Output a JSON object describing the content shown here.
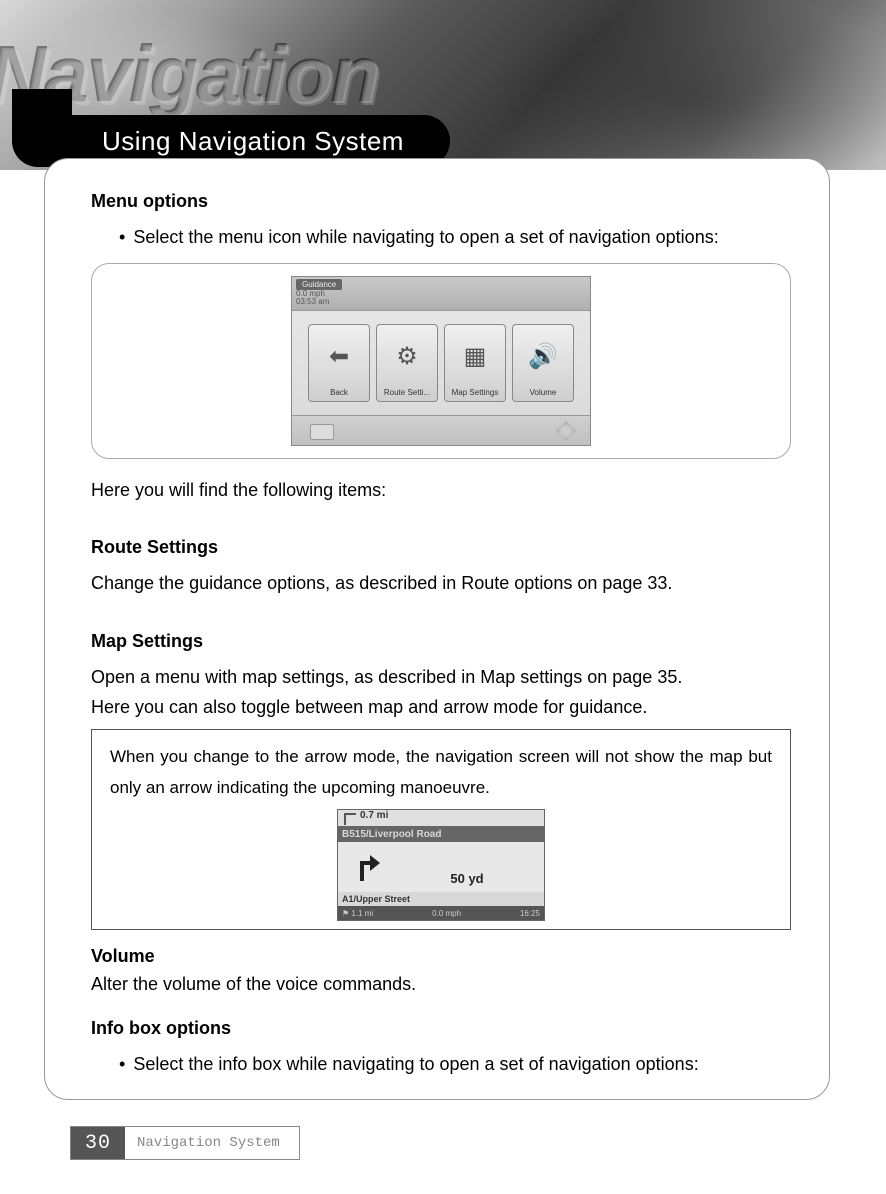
{
  "header": {
    "background_word": "Navigation",
    "title": "Using Navigation System"
  },
  "sections": {
    "menu_options": {
      "heading": "Menu options",
      "bullet": "Select the menu icon while navigating to open a set of navigation options:",
      "after_figure": "Here you will find the following items:"
    },
    "route_settings": {
      "heading": "Route Settings",
      "body": "Change the guidance options, as described in  Route options  on page 33."
    },
    "map_settings": {
      "heading": "Map Settings",
      "body1": "Open a menu with map settings, as described in Map settings on page 35.",
      "body2": "Here you can also toggle between map and arrow mode for guidance.",
      "note": "When you change to the arrow mode, the navigation screen will not show the map but only an arrow indicating the upcoming manoeuvre."
    },
    "volume": {
      "heading": "Volume",
      "body": "Alter the volume of the voice commands."
    },
    "info_box": {
      "heading": "Info box options",
      "bullet": "Select the info box while navigating to open a set of navigation options:"
    }
  },
  "figure1": {
    "top_tag": "Guidance",
    "top_speed": "0.0 mph",
    "top_time1": "03:53 am",
    "top_time2": "03:53 am",
    "tiles": [
      {
        "label": "Back",
        "icon": "⬅"
      },
      {
        "label": "Route Setti...",
        "icon": "⚙"
      },
      {
        "label": "Map Settings",
        "icon": "▦"
      },
      {
        "label": "Volume",
        "icon": "🔊"
      }
    ]
  },
  "figure2": {
    "ahead_dist": "0.7 mi",
    "road": "B515/Liverpool Road",
    "turn_dist": "50 yd",
    "current_road": "A1/Upper Street",
    "status_dist": "1.1 mi",
    "status_speed": "0.0 mph",
    "status_time": "16:25"
  },
  "footer": {
    "page_number": "30",
    "label": "Navigation System"
  }
}
